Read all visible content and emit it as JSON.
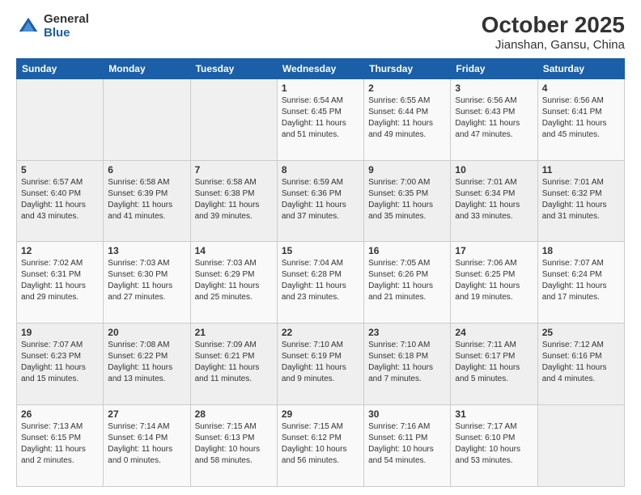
{
  "header": {
    "logo_general": "General",
    "logo_blue": "Blue",
    "title": "October 2025",
    "subtitle": "Jianshan, Gansu, China"
  },
  "weekdays": [
    "Sunday",
    "Monday",
    "Tuesday",
    "Wednesday",
    "Thursday",
    "Friday",
    "Saturday"
  ],
  "weeks": [
    [
      {
        "day": "",
        "info": ""
      },
      {
        "day": "",
        "info": ""
      },
      {
        "day": "",
        "info": ""
      },
      {
        "day": "1",
        "info": "Sunrise: 6:54 AM\nSunset: 6:45 PM\nDaylight: 11 hours\nand 51 minutes."
      },
      {
        "day": "2",
        "info": "Sunrise: 6:55 AM\nSunset: 6:44 PM\nDaylight: 11 hours\nand 49 minutes."
      },
      {
        "day": "3",
        "info": "Sunrise: 6:56 AM\nSunset: 6:43 PM\nDaylight: 11 hours\nand 47 minutes."
      },
      {
        "day": "4",
        "info": "Sunrise: 6:56 AM\nSunset: 6:41 PM\nDaylight: 11 hours\nand 45 minutes."
      }
    ],
    [
      {
        "day": "5",
        "info": "Sunrise: 6:57 AM\nSunset: 6:40 PM\nDaylight: 11 hours\nand 43 minutes."
      },
      {
        "day": "6",
        "info": "Sunrise: 6:58 AM\nSunset: 6:39 PM\nDaylight: 11 hours\nand 41 minutes."
      },
      {
        "day": "7",
        "info": "Sunrise: 6:58 AM\nSunset: 6:38 PM\nDaylight: 11 hours\nand 39 minutes."
      },
      {
        "day": "8",
        "info": "Sunrise: 6:59 AM\nSunset: 6:36 PM\nDaylight: 11 hours\nand 37 minutes."
      },
      {
        "day": "9",
        "info": "Sunrise: 7:00 AM\nSunset: 6:35 PM\nDaylight: 11 hours\nand 35 minutes."
      },
      {
        "day": "10",
        "info": "Sunrise: 7:01 AM\nSunset: 6:34 PM\nDaylight: 11 hours\nand 33 minutes."
      },
      {
        "day": "11",
        "info": "Sunrise: 7:01 AM\nSunset: 6:32 PM\nDaylight: 11 hours\nand 31 minutes."
      }
    ],
    [
      {
        "day": "12",
        "info": "Sunrise: 7:02 AM\nSunset: 6:31 PM\nDaylight: 11 hours\nand 29 minutes."
      },
      {
        "day": "13",
        "info": "Sunrise: 7:03 AM\nSunset: 6:30 PM\nDaylight: 11 hours\nand 27 minutes."
      },
      {
        "day": "14",
        "info": "Sunrise: 7:03 AM\nSunset: 6:29 PM\nDaylight: 11 hours\nand 25 minutes."
      },
      {
        "day": "15",
        "info": "Sunrise: 7:04 AM\nSunset: 6:28 PM\nDaylight: 11 hours\nand 23 minutes."
      },
      {
        "day": "16",
        "info": "Sunrise: 7:05 AM\nSunset: 6:26 PM\nDaylight: 11 hours\nand 21 minutes."
      },
      {
        "day": "17",
        "info": "Sunrise: 7:06 AM\nSunset: 6:25 PM\nDaylight: 11 hours\nand 19 minutes."
      },
      {
        "day": "18",
        "info": "Sunrise: 7:07 AM\nSunset: 6:24 PM\nDaylight: 11 hours\nand 17 minutes."
      }
    ],
    [
      {
        "day": "19",
        "info": "Sunrise: 7:07 AM\nSunset: 6:23 PM\nDaylight: 11 hours\nand 15 minutes."
      },
      {
        "day": "20",
        "info": "Sunrise: 7:08 AM\nSunset: 6:22 PM\nDaylight: 11 hours\nand 13 minutes."
      },
      {
        "day": "21",
        "info": "Sunrise: 7:09 AM\nSunset: 6:21 PM\nDaylight: 11 hours\nand 11 minutes."
      },
      {
        "day": "22",
        "info": "Sunrise: 7:10 AM\nSunset: 6:19 PM\nDaylight: 11 hours\nand 9 minutes."
      },
      {
        "day": "23",
        "info": "Sunrise: 7:10 AM\nSunset: 6:18 PM\nDaylight: 11 hours\nand 7 minutes."
      },
      {
        "day": "24",
        "info": "Sunrise: 7:11 AM\nSunset: 6:17 PM\nDaylight: 11 hours\nand 5 minutes."
      },
      {
        "day": "25",
        "info": "Sunrise: 7:12 AM\nSunset: 6:16 PM\nDaylight: 11 hours\nand 4 minutes."
      }
    ],
    [
      {
        "day": "26",
        "info": "Sunrise: 7:13 AM\nSunset: 6:15 PM\nDaylight: 11 hours\nand 2 minutes."
      },
      {
        "day": "27",
        "info": "Sunrise: 7:14 AM\nSunset: 6:14 PM\nDaylight: 11 hours\nand 0 minutes."
      },
      {
        "day": "28",
        "info": "Sunrise: 7:15 AM\nSunset: 6:13 PM\nDaylight: 10 hours\nand 58 minutes."
      },
      {
        "day": "29",
        "info": "Sunrise: 7:15 AM\nSunset: 6:12 PM\nDaylight: 10 hours\nand 56 minutes."
      },
      {
        "day": "30",
        "info": "Sunrise: 7:16 AM\nSunset: 6:11 PM\nDaylight: 10 hours\nand 54 minutes."
      },
      {
        "day": "31",
        "info": "Sunrise: 7:17 AM\nSunset: 6:10 PM\nDaylight: 10 hours\nand 53 minutes."
      },
      {
        "day": "",
        "info": ""
      }
    ]
  ]
}
